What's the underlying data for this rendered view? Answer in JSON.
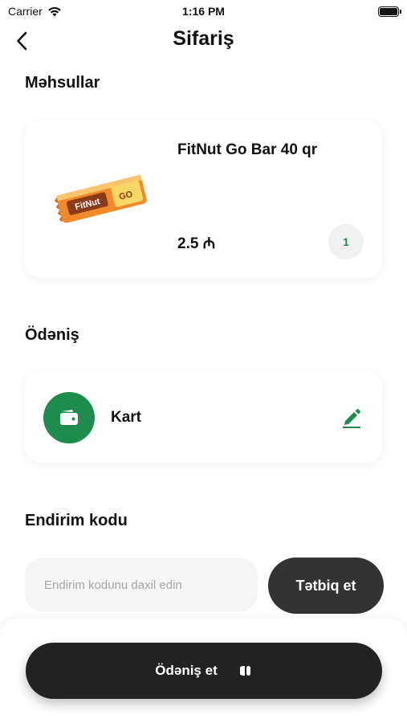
{
  "status_bar": {
    "carrier": "Carrier",
    "time": "1:16 PM"
  },
  "nav": {
    "title": "Sifariş",
    "back_icon": "chevron-left-icon"
  },
  "products": {
    "section_title": "Məhsullar",
    "items": [
      {
        "name": "FitNut Go Bar 40 qr",
        "price": "2.5 ₼",
        "quantity": "1",
        "image": "snack-bar-image"
      }
    ]
  },
  "payment": {
    "section_title": "Ödəniş",
    "method_label": "Kart",
    "method_icon": "wallet-icon",
    "edit_icon": "pencil-icon"
  },
  "promo": {
    "section_title": "Endirim kodu",
    "placeholder": "Endirim kodunu daxil edin",
    "value": "",
    "apply_label": "Tətbiq et"
  },
  "checkout": {
    "pay_label": "Ödəniş et",
    "pay_icon": "toggle-icon"
  },
  "colors": {
    "accent": "#1e8c4e",
    "dark_button": "#222222",
    "apply_button": "#333333",
    "input_bg": "#f6f6f6"
  }
}
